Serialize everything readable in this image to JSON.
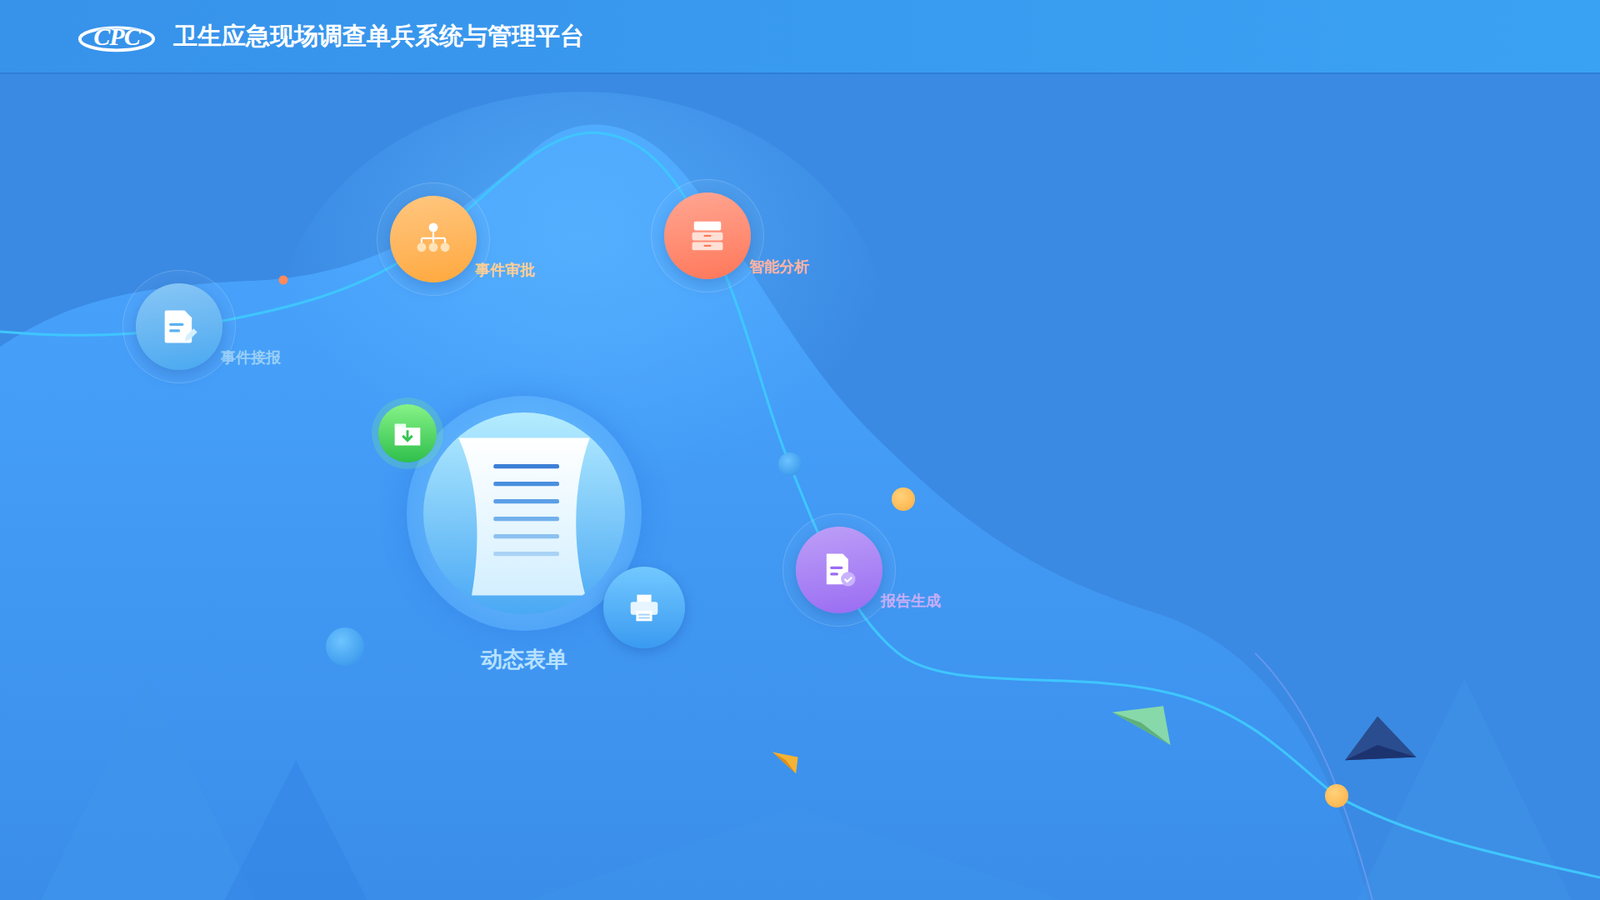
{
  "header": {
    "logo": "CPC",
    "title": "卫生应急现场调查单兵系统与管理平台"
  },
  "modules": [
    {
      "label": "事件接报",
      "color": "#48a8f0"
    },
    {
      "label": "事件审批",
      "color": "#ffa83a"
    },
    {
      "label": "智能分析",
      "color": "#ff7658"
    },
    {
      "label": "报告生成",
      "color": "#9a6bf2"
    }
  ],
  "center": {
    "label": "动态表单"
  }
}
